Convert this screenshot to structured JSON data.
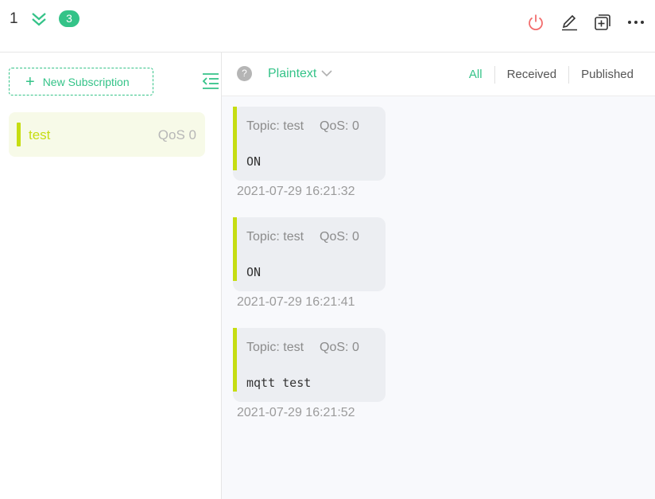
{
  "header": {
    "connection_name": "1",
    "unread_count": "3",
    "actions": [
      "power-icon",
      "edit-icon",
      "new-window-icon",
      "more-icon"
    ]
  },
  "sidebar": {
    "new_subscription_label": "New Subscription",
    "subscriptions": [
      {
        "topic": "test",
        "qos": "QoS 0",
        "color": "#c6dd12"
      }
    ]
  },
  "filterbar": {
    "format": "Plaintext",
    "tabs": [
      "All",
      "Received",
      "Published"
    ],
    "active_tab": "All"
  },
  "messages": [
    {
      "topic": "Topic: test",
      "qos": "QoS: 0",
      "payload": "ON",
      "time": "2021-07-29 16:21:32"
    },
    {
      "topic": "Topic: test",
      "qos": "QoS: 0",
      "payload": "ON",
      "time": "2021-07-29 16:21:41"
    },
    {
      "topic": "Topic: test",
      "qos": "QoS: 0",
      "payload": "mqtt test",
      "time": "2021-07-29 16:21:52"
    }
  ],
  "colors": {
    "brand": "#34c388",
    "accent": "#c6dd12",
    "danger": "#f26d6d"
  }
}
